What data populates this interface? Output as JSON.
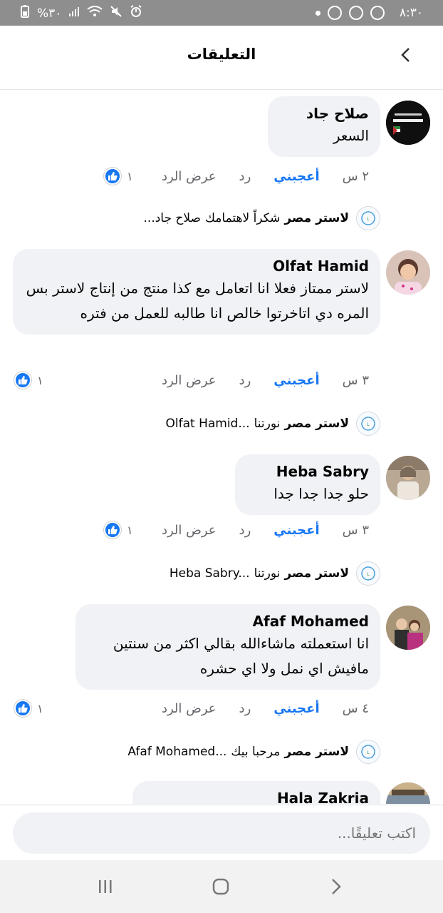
{
  "status_bar": {
    "time": "٨:٣٠",
    "battery": "%٣٠"
  },
  "header": {
    "title": "التعليقات"
  },
  "comments": [
    {
      "author": "صلاح جاد",
      "text": "السعر",
      "time": "٢ س",
      "like_label": "أعجبني",
      "reply_label": "رد",
      "view_reply_label": "عرض الرد",
      "reactions": "١",
      "reply": {
        "author": "لاستر مصر",
        "text": "شكراً لاهتمامك",
        "mention": "صلاح جاد..."
      }
    },
    {
      "author": "Olfat Hamid",
      "text": "لاستر ممتاز فعلا انا اتعامل مع كذا منتج من إنتاج لاستر بس المره دي اتاخرتوا خالص انا طالبه للعمل من فتره",
      "time": "٣ س",
      "like_label": "أعجبني",
      "reply_label": "رد",
      "view_reply_label": "عرض الرد",
      "reactions": "١",
      "reply": {
        "author": "لاستر مصر",
        "text": "نورتنا",
        "mention": "Olfat Hamid..."
      }
    },
    {
      "author": "Heba Sabry",
      "text": "حلو جدا جدا جدا",
      "time": "٣ س",
      "like_label": "أعجبني",
      "reply_label": "رد",
      "view_reply_label": "عرض الرد",
      "reactions": "١",
      "reply": {
        "author": "لاستر مصر",
        "text": "نورتنا",
        "mention": "Heba Sabry..."
      }
    },
    {
      "author": "Afaf Mohamed",
      "text": "انا استعملته ماشاءالله بقالي اكثر من سنتين مافيش اي نمل ولا اي حشره",
      "time": "٤ س",
      "like_label": "أعجبني",
      "reply_label": "رد",
      "view_reply_label": "عرض الرد",
      "reactions": "١",
      "reply": {
        "author": "لاستر مصر",
        "text": "مرحبا بيك",
        "mention": "Afaf Mohamed..."
      }
    },
    {
      "author": "Hala Zakria"
    }
  ],
  "composer": {
    "placeholder": "اكتب تعليقًا..."
  },
  "colors": {
    "accent": "#1877f2",
    "bubble": "#f0f2f5",
    "status_bar": "#8e8e8e"
  },
  "icons": {
    "back": "chevron-left-icon",
    "like_reaction": "thumbs-up-icon",
    "nav_recents": "recents-icon",
    "nav_home": "home-icon",
    "nav_back": "nav-back-icon"
  }
}
